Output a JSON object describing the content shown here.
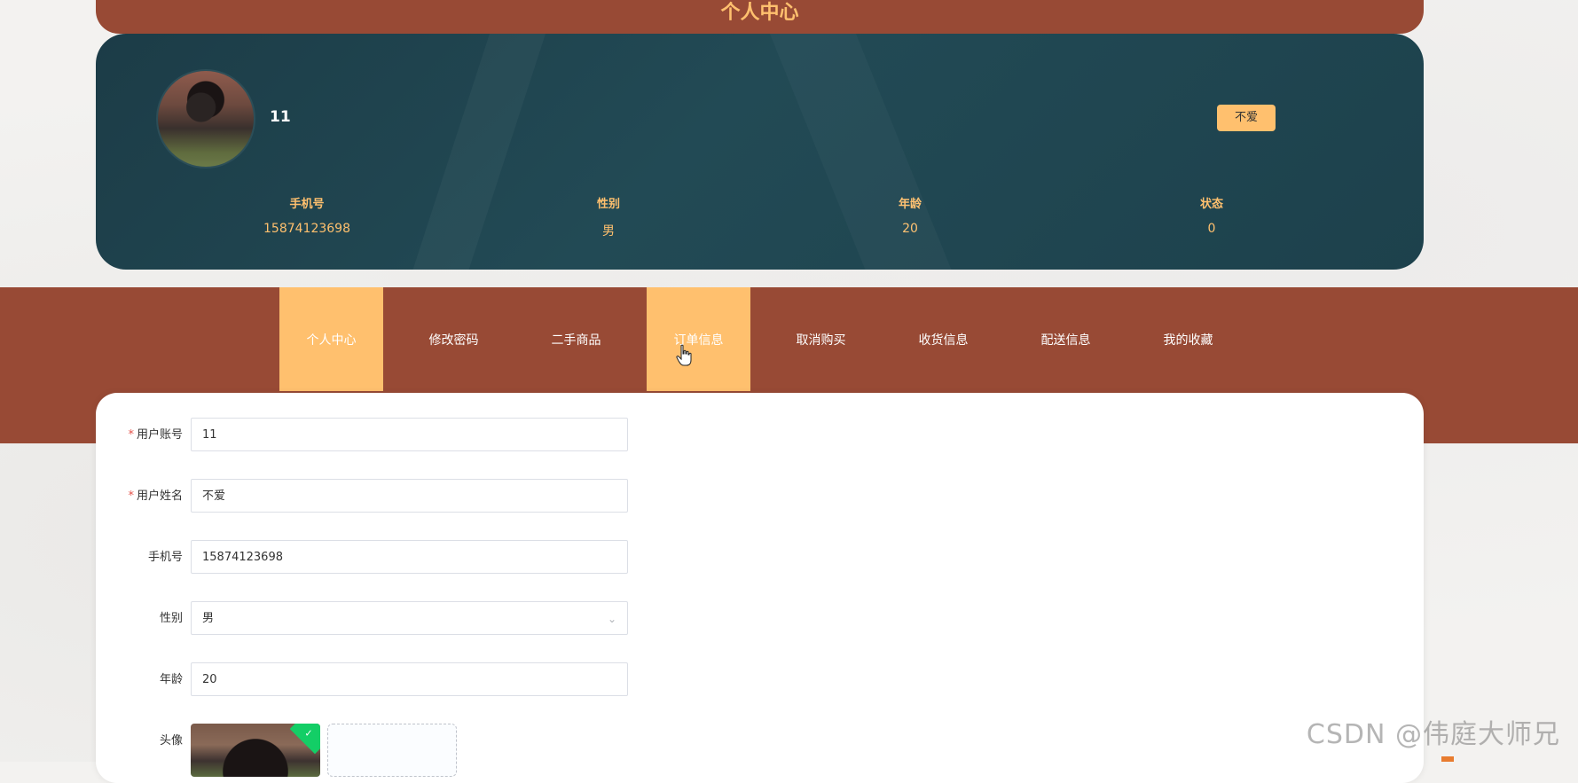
{
  "header": {
    "title": "个人中心"
  },
  "profile": {
    "username": "11",
    "name_badge": "不爱",
    "stats": [
      {
        "label": "手机号",
        "value": "15874123698"
      },
      {
        "label": "性别",
        "value": "男"
      },
      {
        "label": "年龄",
        "value": "20"
      },
      {
        "label": "状态",
        "value": "0"
      }
    ]
  },
  "nav": {
    "tabs": [
      {
        "label": "个人中心",
        "active": true
      },
      {
        "label": "修改密码",
        "active": false
      },
      {
        "label": "二手商品",
        "active": false
      },
      {
        "label": "订单信息",
        "active": true
      },
      {
        "label": "取消购买",
        "active": false
      },
      {
        "label": "收货信息",
        "active": false
      },
      {
        "label": "配送信息",
        "active": false
      },
      {
        "label": "我的收藏",
        "active": false
      }
    ]
  },
  "form": {
    "account": {
      "label": "用户账号",
      "value": "11",
      "required": "*"
    },
    "name": {
      "label": "用户姓名",
      "value": "不爱",
      "required": "*"
    },
    "phone": {
      "label": "手机号",
      "value": "15874123698"
    },
    "gender": {
      "label": "性别",
      "value": "男"
    },
    "age": {
      "label": "年龄",
      "value": "20"
    },
    "avatar": {
      "label": "头像"
    }
  },
  "watermark": "CSDN @伟庭大师兄",
  "colors": {
    "brand_rust": "#984a35",
    "accent_gold": "#ffc06e",
    "card_teal": "#1f4450"
  }
}
